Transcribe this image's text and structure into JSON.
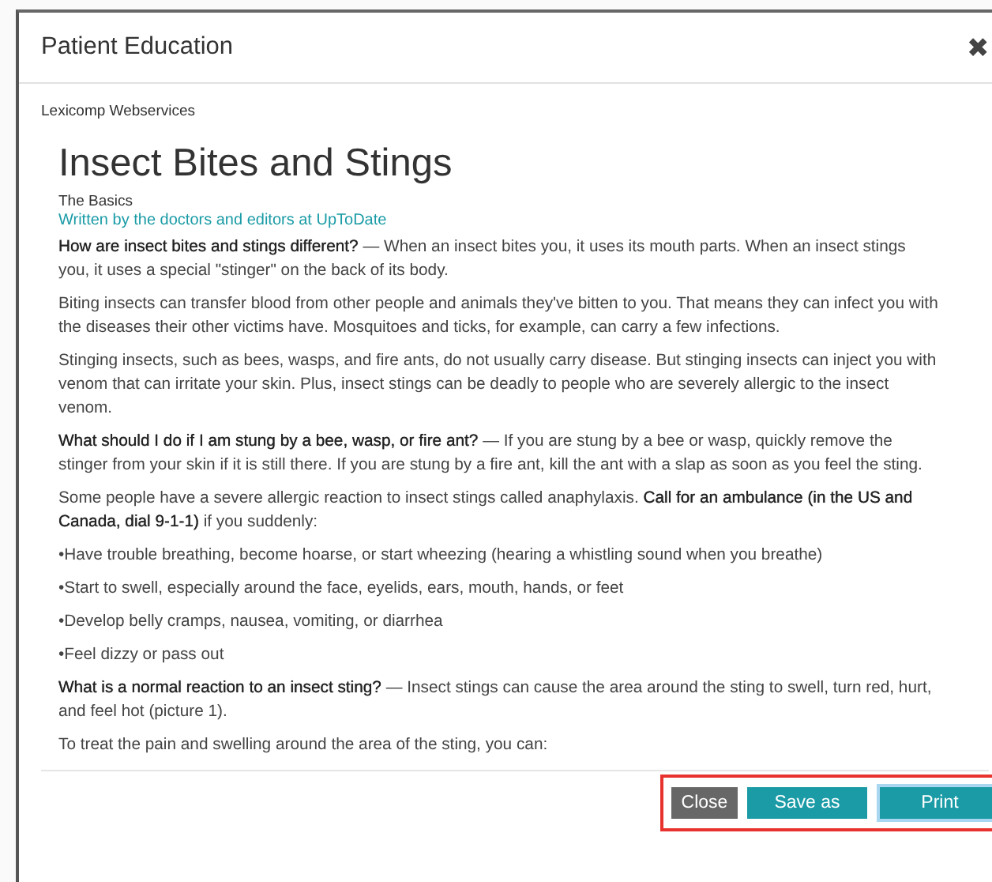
{
  "dialog": {
    "title": "Patient Education",
    "close_icon": "✖"
  },
  "source": "Lexicomp Webservices",
  "article": {
    "title": "Insect Bites and Stings",
    "subtitle": "The Basics",
    "byline": "Written by the doctors and editors at UpToDate",
    "paragraphs": [
      "**How are insect bites and stings different?** — When an insect bites you, it uses its mouth parts. When an insect stings you, it uses a special \"stinger\" on the back of its body.",
      "Biting insects can transfer blood from other people and animals they've bitten to you. That means they can infect you with the diseases their other victims have. Mosquitoes and ticks, for example, can carry a few infections.",
      "Stinging insects, such as bees, wasps, and fire ants, do not usually carry disease. But stinging insects can inject you with venom that can irritate your skin. Plus, insect stings can be deadly to people who are severely allergic to the insect venom.",
      "**What should I do if I am stung by a bee, wasp, or fire ant?** — If you are stung by a bee or wasp, quickly remove the stinger from your skin if it is still there. If you are stung by a fire ant, kill the ant with a slap as soon as you feel the sting.",
      "Some people have a severe allergic reaction to insect stings called anaphylaxis. **Call for an ambulance (in the US and Canada, dial 9-1-1)** if you suddenly:",
      "•Have trouble breathing, become hoarse, or start wheezing (hearing a whistling sound when you breathe)",
      "•Start to swell, especially around the face, eyelids, ears, mouth, hands, or feet",
      "•Develop belly cramps, nausea, vomiting, or diarrhea",
      "•Feel dizzy or pass out",
      "**What is a normal reaction to an insect sting?** — Insect stings can cause the area around the sting to swell, turn red, hurt, and feel hot (picture 1).",
      "To treat the pain and swelling around the area of the sting, you can:"
    ]
  },
  "footer": {
    "highlighted": true,
    "buttons": [
      {
        "label": "Close",
        "kind": "secondary"
      },
      {
        "label": "Save as",
        "kind": "primary"
      },
      {
        "label": "Print",
        "kind": "focused"
      }
    ]
  }
}
